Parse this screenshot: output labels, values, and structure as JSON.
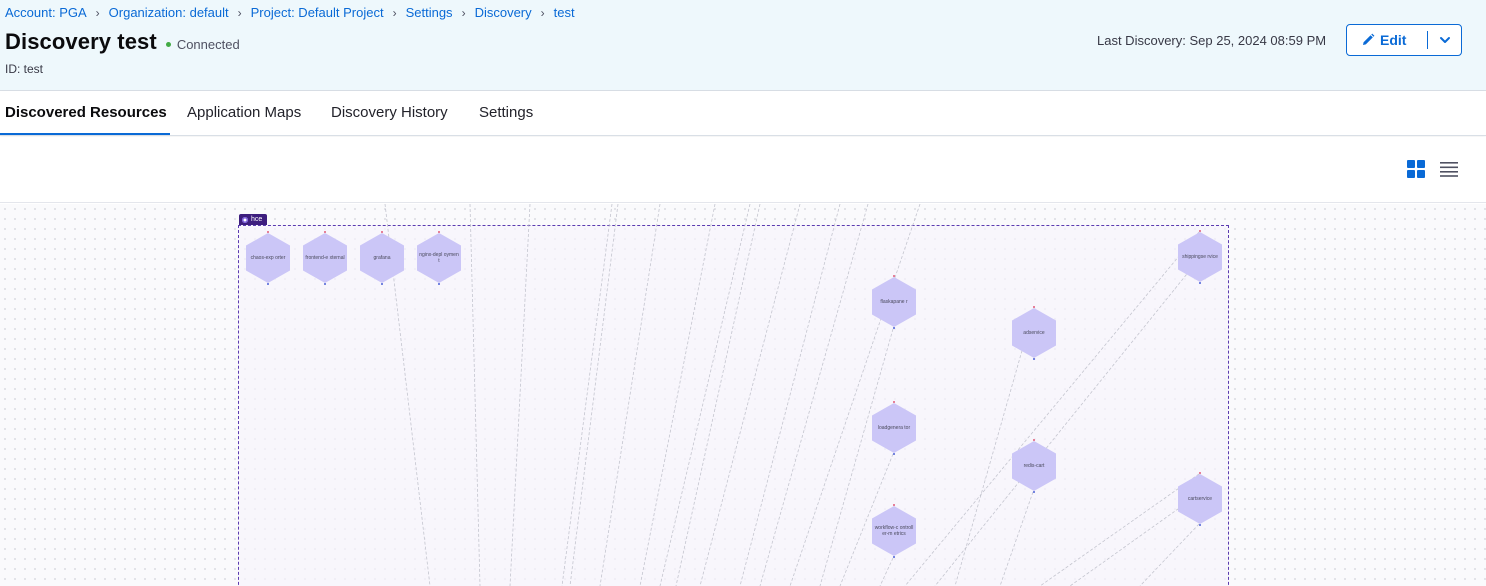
{
  "breadcrumb": {
    "items": [
      "Account: PGA",
      "Organization: default",
      "Project: Default Project",
      "Settings",
      "Discovery",
      "test"
    ]
  },
  "header": {
    "title": "Discovery test",
    "status": "Connected",
    "id_line": "ID: test",
    "last_discovery": "Last Discovery: Sep 25, 2024 08:59 PM",
    "edit_label": "Edit"
  },
  "tabs": [
    "Discovered Resources",
    "Application Maps",
    "Discovery History",
    "Settings"
  ],
  "active_tab": "Discovered Resources",
  "toolbar": {
    "views": [
      "grid-view-icon",
      "list-view-icon"
    ],
    "active_view": "grid-view-icon"
  },
  "graph": {
    "namespace": "hce",
    "nodes": [
      "chaos-exp orter",
      "frontend-e xternal",
      "grafana",
      "nginx-depl oyment",
      "flaskapane r",
      "adservice",
      "loadgenera tor",
      "redis-cart",
      "workflow-c ontroller-m etrics",
      "shippingse rvice",
      "cartservice"
    ]
  },
  "colors": {
    "accent": "#0a6ad6",
    "status_connected": "#42ab45",
    "node_fill": "#cbc6f7",
    "namespace_tag": "#3d1e7e",
    "header_bg": "#eef8fc"
  }
}
